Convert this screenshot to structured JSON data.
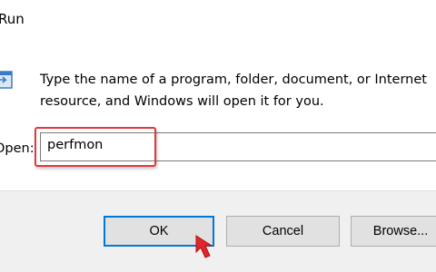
{
  "window": {
    "title": "Run",
    "icon": "run-dialog-icon"
  },
  "dialog": {
    "description_line1": "Type the name of a program, folder, document, or Internet",
    "description_line2": "resource, and Windows will open it for you.",
    "open_label": "Open:",
    "open_value": "perfmon",
    "open_highlight_color": "#e0393e"
  },
  "buttons": {
    "ok_label": "OK",
    "cancel_label": "Cancel",
    "browse_label": "Browse..."
  },
  "annotation": {
    "arrow_icon": "red-pointer-arrow-icon",
    "arrow_color": "#e0262b"
  },
  "colors": {
    "focus_border": "#0078d7",
    "button_face": "#e1e1e1",
    "footer_bg": "#f0f0f0"
  }
}
